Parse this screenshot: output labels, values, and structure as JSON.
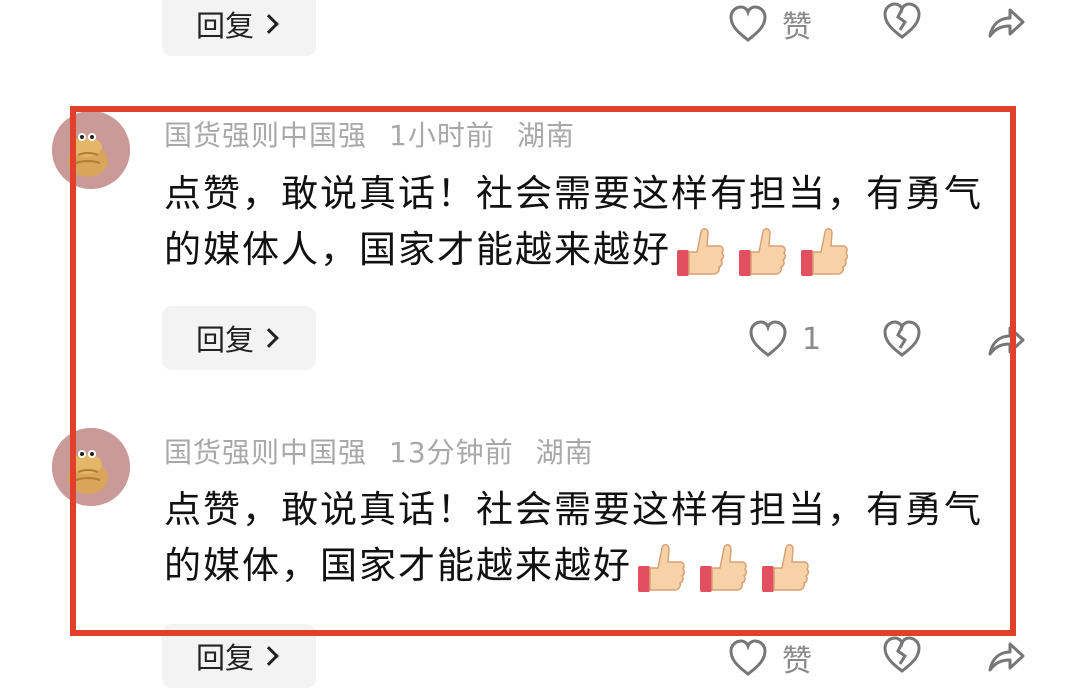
{
  "top_row": {
    "reply_label": "回复",
    "like_label": "赞"
  },
  "comments": [
    {
      "username": "国货强则中国强",
      "time": "1小时前",
      "location": "湖南",
      "text": "点赞，敢说真话！社会需要这样有担当，有勇气的媒体人，国家才能越来越好",
      "reply_label": "回复",
      "like_count": "1"
    },
    {
      "username": "国货强则中国强",
      "time": "13分钟前",
      "location": "湖南",
      "text": "点赞，敢说真话！社会需要这样有担当，有勇气的媒体，国家才能越来越好",
      "reply_label": "回复",
      "like_label": "赞"
    }
  ],
  "colors": {
    "highlight": "#e0412b",
    "meta_text": "#a8a8a8",
    "icon": "#777777"
  }
}
